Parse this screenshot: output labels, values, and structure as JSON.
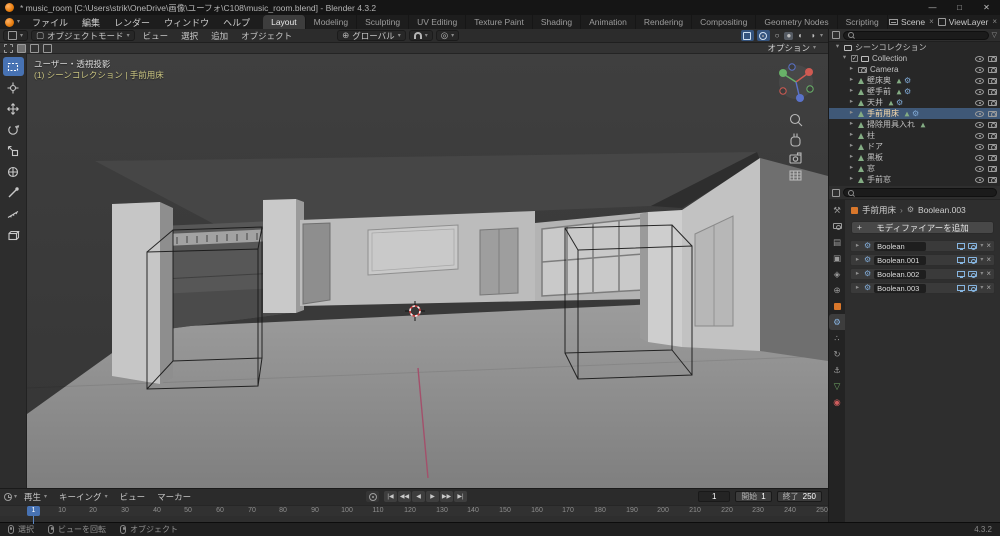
{
  "window": {
    "title": "* music_room [C:\\Users\\strik\\OneDrive\\画像\\ユーフォ\\C108\\music_room.blend] - Blender 4.3.2",
    "controls": {
      "minimize": "—",
      "maximize": "□",
      "close": "✕"
    }
  },
  "menu_bar": {
    "menus": [
      "ファイル",
      "編集",
      "レンダー",
      "ウィンドウ",
      "ヘルプ"
    ],
    "workspaces": [
      "Layout",
      "Modeling",
      "Sculpting",
      "UV Editing",
      "Texture Paint",
      "Shading",
      "Animation",
      "Rendering",
      "Compositing",
      "Geometry Nodes",
      "Scripting"
    ],
    "active_workspace": "Layout",
    "scene_label": "Scene",
    "view_layer_label": "ViewLayer"
  },
  "viewport_header": {
    "mode": "オブジェクトモード",
    "menus": [
      "ビュー",
      "選択",
      "追加",
      "オブジェクト"
    ],
    "orientation": "グローバル",
    "options_label": "オプション"
  },
  "viewport_overlay": {
    "view_label": "ユーザー・透視投影",
    "context_label": "(1) シーンコレクション | 手前用床"
  },
  "outliner": {
    "root": "シーンコレクション",
    "items": [
      {
        "label": "Collection"
      },
      {
        "label": "Camera"
      },
      {
        "label": "壁床奥"
      },
      {
        "label": "壁手前"
      },
      {
        "label": "天井"
      },
      {
        "label": "手前用床",
        "selected": true
      },
      {
        "label": "掃除用具入れ"
      },
      {
        "label": "柱"
      },
      {
        "label": "ドア"
      },
      {
        "label": "黒板"
      },
      {
        "label": "窓"
      },
      {
        "label": "手前窓"
      }
    ]
  },
  "properties": {
    "breadcrumb": {
      "object": "手前用床",
      "separator": "›",
      "modifier": "Boolean.003"
    },
    "add_modifier_label": "モディファイアーを追加",
    "modifiers": [
      {
        "name": "Boolean"
      },
      {
        "name": "Boolean.001"
      },
      {
        "name": "Boolean.002"
      },
      {
        "name": "Boolean.003"
      }
    ]
  },
  "timeline": {
    "menus": [
      "再生",
      "キーイング",
      "ビュー",
      "マーカー"
    ],
    "playback": [
      "|◀",
      "◀◀",
      "◀",
      "▶",
      "▶▶",
      "▶|"
    ],
    "current_frame": "1",
    "start_label": "開始",
    "start_value": "1",
    "end_label": "終了",
    "end_value": "250",
    "ruler": [
      "0",
      "10",
      "20",
      "30",
      "40",
      "50",
      "60",
      "70",
      "80",
      "90",
      "100",
      "110",
      "120",
      "130",
      "140",
      "150",
      "160",
      "170",
      "180",
      "190",
      "200",
      "210",
      "220",
      "230",
      "240",
      "250"
    ]
  },
  "status_bar": {
    "items": [
      "選択",
      "ビューを回転",
      "オブジェクト"
    ],
    "version": "4.3.2"
  },
  "icons": {
    "caret_down": "▾",
    "disclosure_open": "▾",
    "disclosure_closed": "▸",
    "close": "×",
    "check": "✓",
    "gear": "⚙",
    "plus": "+",
    "filter": "▽",
    "mode_cube": "▢",
    "globe": "⊕",
    "prop_edit": "◎",
    "wireframe": "○",
    "solid": "●",
    "material_preview": "◐",
    "rendered": "◑",
    "tab_tool": "⚒",
    "tab_output": "▤",
    "tab_view_layer": "▣",
    "tab_scene": "◈",
    "tab_world": "⊕",
    "tab_particles": "∴",
    "tab_physics": "↻",
    "tab_constraints": "⚓",
    "tab_data": "▽",
    "tab_material": "◉"
  }
}
